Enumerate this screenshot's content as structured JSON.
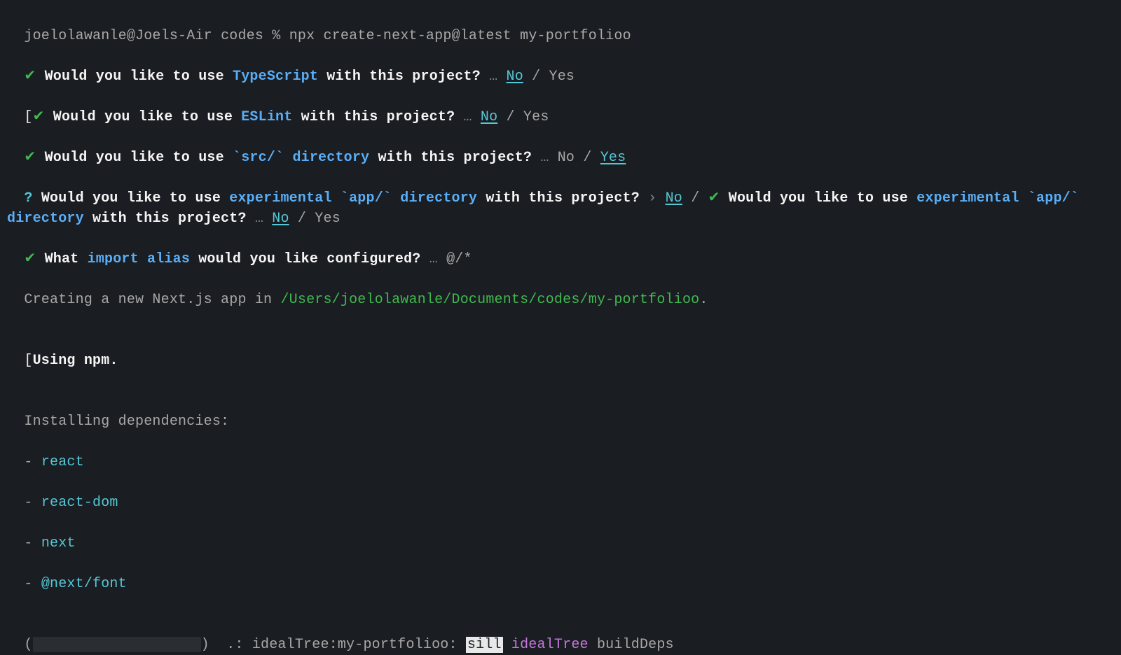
{
  "prompt_line": {
    "user_host": "joelolawanle@Joels-Air",
    "cwd": "codes",
    "symbol": "%",
    "command": "npx create-next-app@latest my-portfolioo"
  },
  "q1": {
    "check": "✔",
    "prefix": "Would you like to use ",
    "em": "TypeScript",
    "suffix": " with this project?",
    "ell": "…",
    "opt_no": "No",
    "slash": "/",
    "opt_yes": "Yes"
  },
  "q2": {
    "bracket": "[",
    "check": "✔",
    "prefix": "Would you like to use ",
    "em": "ESLint",
    "suffix": " with this project?",
    "ell": "…",
    "opt_no": "No",
    "slash": "/",
    "opt_yes": "Yes",
    "bracket_close": "]"
  },
  "q3": {
    "check": "✔",
    "prefix": "Would you like to use ",
    "em": "`src/` directory",
    "suffix": " with this project?",
    "ell": "…",
    "opt_no": "No",
    "slash": "/",
    "opt_yes": "Yes"
  },
  "q4": {
    "q": "?",
    "prefix": "Would you like to use ",
    "em": "experimental `app/` directory",
    "suffix": " with this project?",
    "arrow": "›",
    "opt_no": "No",
    "slash": "/",
    "check": "✔",
    "prefix2": "Would you like to use ",
    "em2": "experimental `app/` directory",
    "suffix2": " with this project?",
    "ell": "…",
    "opt_no2": "No",
    "slash2": "/",
    "opt_yes2": "Yes"
  },
  "q5": {
    "check": "✔",
    "pre": "What ",
    "em": "import alias",
    "post": " would you like configured?",
    "ell": "…",
    "answer": "@/*"
  },
  "creating": {
    "text": "Creating a new Next.js app in ",
    "path": "/Users/joelolawanle/Documents/codes/my-portfolioo",
    "dot": "."
  },
  "using": {
    "bracket": "[",
    "text": "Using npm.",
    "bracket_close": "]"
  },
  "installing": {
    "header": "Installing dependencies:",
    "deps": [
      "react",
      "react-dom",
      "next",
      "@next/font"
    ]
  },
  "status": {
    "lp": "(",
    "rp": ")",
    "spin": ".:",
    "label": "idealTree:my-portfolioo:",
    "sill": "sill",
    "idealTree": "idealTree",
    "buildDeps": "buildDeps"
  }
}
